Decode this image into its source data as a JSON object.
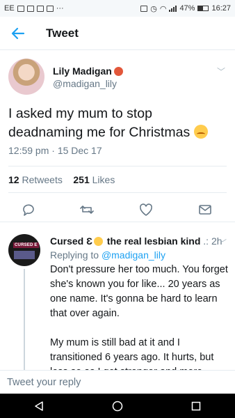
{
  "status_bar": {
    "left_text": "EE",
    "battery": "47%",
    "time": "16:27"
  },
  "header": {
    "title": "Tweet",
    "back_icon": "arrow-left-icon"
  },
  "tweet": {
    "author_name": "Lily Madigan",
    "author_handle": "@madigan_lily",
    "text": "I asked my mum to stop deadnaming me for Christmas",
    "timestamp": "12:59 pm · 15 Dec 17",
    "retweets_count": "12",
    "retweets_label": "Retweets",
    "likes_count": "251",
    "likes_label": "Likes"
  },
  "reply": {
    "author_name": "Cursed Ɛ",
    "author_name_suffix": "the real lesbian kind",
    "meta": ".: 2h",
    "replying_prefix": "Replying to",
    "replying_to": "@madigan_lily",
    "avatar_text": "CURSED E",
    "paragraphs": [
      "Don't pressure her too much. You forget she's known you for like... 20 years as one name. It's gonna be hard to learn that over again.",
      "My mum is still bad at it and I transitioned 6 years ago. It hurts, but less so as I get stronger and more"
    ]
  },
  "compose": {
    "placeholder": "Tweet your reply"
  },
  "colors": {
    "accent": "#1da1f2",
    "secondary_text": "#657786",
    "divider": "#e6ecf0"
  }
}
